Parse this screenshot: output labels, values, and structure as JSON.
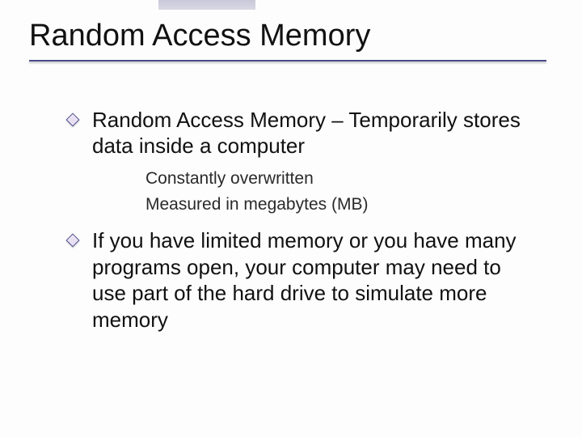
{
  "title": "Random Access Memory",
  "bullets": [
    {
      "text": "Random Access Memory – Temporarily stores data inside a computer",
      "sub": [
        "Constantly overwritten",
        "Measured in megabytes (MB)"
      ]
    },
    {
      "text": "If you have limited memory or you have many programs open, your computer may need to use part of the hard drive to simulate more memory",
      "sub": []
    }
  ]
}
